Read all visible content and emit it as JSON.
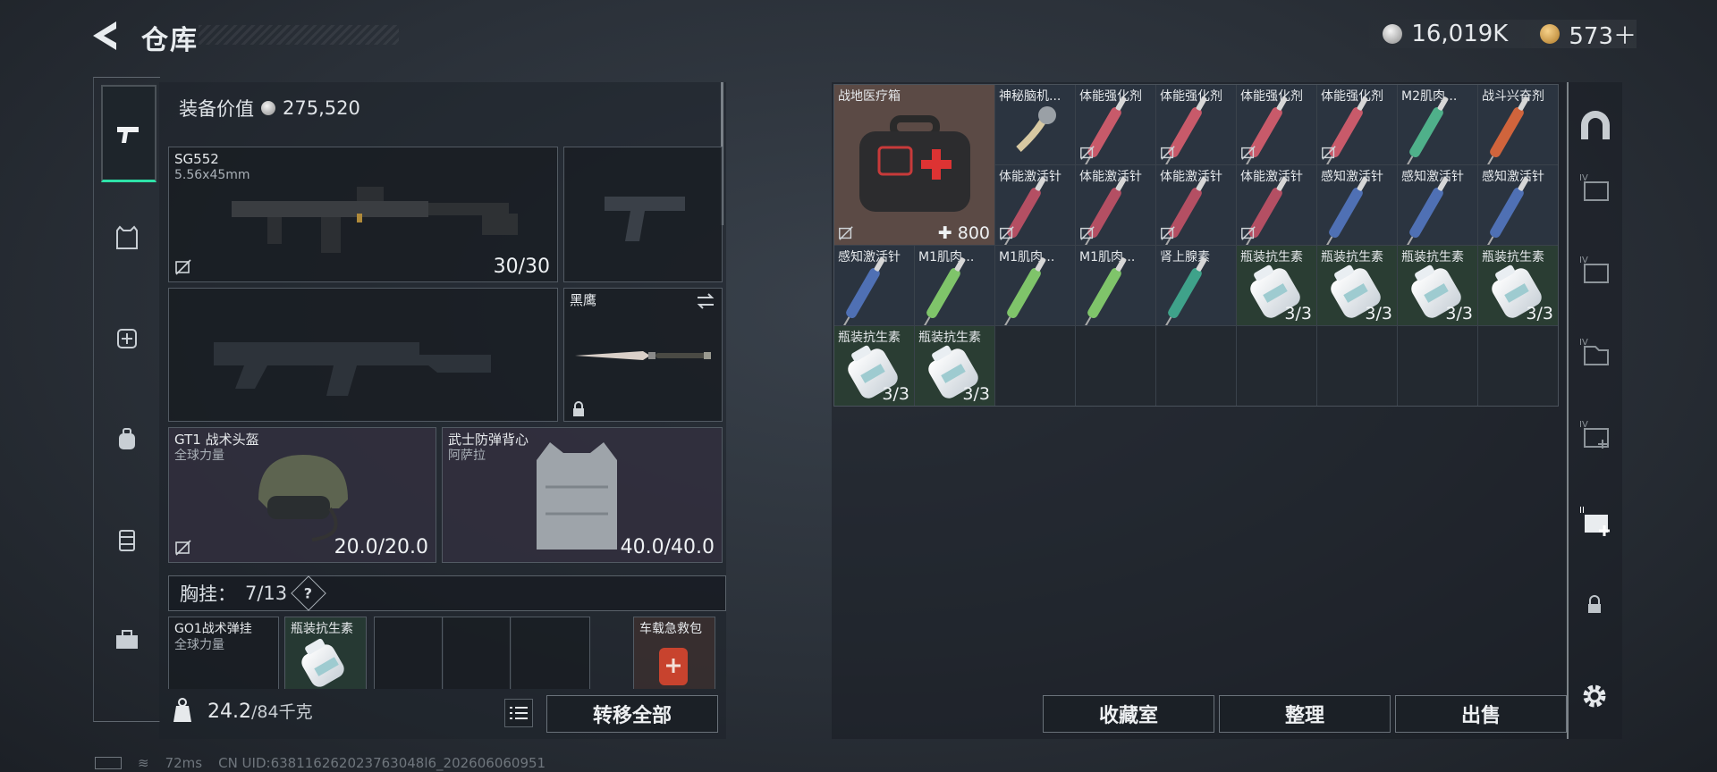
{
  "header": {
    "title": "仓库",
    "silver": "16,019K",
    "gold": "573＋"
  },
  "equipment": {
    "value_label": "装备价值",
    "value": "275,520",
    "primary": {
      "name": "SG552",
      "caliber": "5.56x45mm",
      "ammo": "30/30"
    },
    "melee": {
      "name": "黑鹰"
    },
    "helmet": {
      "name": "GT1 战术头盔",
      "maker": "全球力量",
      "durability": "20.0/20.0"
    },
    "armor": {
      "name": "武士防弹背心",
      "maker": "阿萨拉",
      "durability": "40.0/40.0"
    },
    "chest": {
      "label": "胸挂：",
      "capacity": "7/13",
      "help": "?"
    },
    "chest_items": [
      {
        "name": "GO1战术弹挂",
        "maker": "全球力量"
      },
      {
        "name": "瓶装抗生素"
      },
      {
        "name": "车载急救包"
      }
    ],
    "weight": "24.2",
    "weight_max": "/84千克",
    "move_all": "转移全部"
  },
  "stash": {
    "medkit": {
      "name": "战地医疗箱",
      "count": "800"
    },
    "items": [
      {
        "name": "神秘脑机...",
        "kind": "device"
      },
      {
        "name": "体能强化剂",
        "kind": "syringe",
        "color": "#c85a6a"
      },
      {
        "name": "体能强化剂",
        "kind": "syringe",
        "color": "#c85a6a"
      },
      {
        "name": "体能强化剂",
        "kind": "syringe",
        "color": "#c85a6a"
      },
      {
        "name": "体能强化剂",
        "kind": "syringe",
        "color": "#c85a6a"
      },
      {
        "name": "M2肌肉...",
        "kind": "syringe",
        "color": "#4fb08a"
      },
      {
        "name": "战斗兴奋剂",
        "kind": "syringe",
        "color": "#d0643c"
      },
      {
        "name": "体能激活针",
        "kind": "syringe",
        "color": "#b44f63"
      },
      {
        "name": "体能激活针",
        "kind": "syringe",
        "color": "#b44f63"
      },
      {
        "name": "体能激活针",
        "kind": "syringe",
        "color": "#b44f63"
      },
      {
        "name": "体能激活针",
        "kind": "syringe",
        "color": "#b44f63"
      },
      {
        "name": "感知激活针",
        "kind": "syringe",
        "color": "#4f70b4"
      },
      {
        "name": "感知激活针",
        "kind": "syringe",
        "color": "#4f70b4"
      },
      {
        "name": "感知激活针",
        "kind": "syringe",
        "color": "#4f70b4"
      },
      {
        "name": "感知激活针",
        "kind": "syringe",
        "color": "#4f70b4"
      },
      {
        "name": "M1肌肉...",
        "kind": "syringe",
        "color": "#7fc46a"
      },
      {
        "name": "M1肌肉...",
        "kind": "syringe",
        "color": "#7fc46a"
      },
      {
        "name": "M1肌肉...",
        "kind": "syringe",
        "color": "#7fc46a"
      },
      {
        "name": "肾上腺素",
        "kind": "syringe",
        "color": "#3fa28a"
      },
      {
        "name": "瓶装抗生素",
        "kind": "bottle",
        "count": "3/3"
      },
      {
        "name": "瓶装抗生素",
        "kind": "bottle",
        "count": "3/3"
      },
      {
        "name": "瓶装抗生素",
        "kind": "bottle",
        "count": "3/3"
      },
      {
        "name": "瓶装抗生素",
        "kind": "bottle",
        "count": "3/3"
      },
      {
        "name": "瓶装抗生素",
        "kind": "bottle",
        "count": "3/3"
      },
      {
        "name": "瓶装抗生素",
        "kind": "bottle",
        "count": "3/3"
      }
    ],
    "buttons": {
      "collection": "收藏室",
      "sort": "整理",
      "sell": "出售"
    }
  },
  "status_bar": {
    "ping": "72ms",
    "uid": "CN UID:638116262023763048l6_202606060951"
  }
}
